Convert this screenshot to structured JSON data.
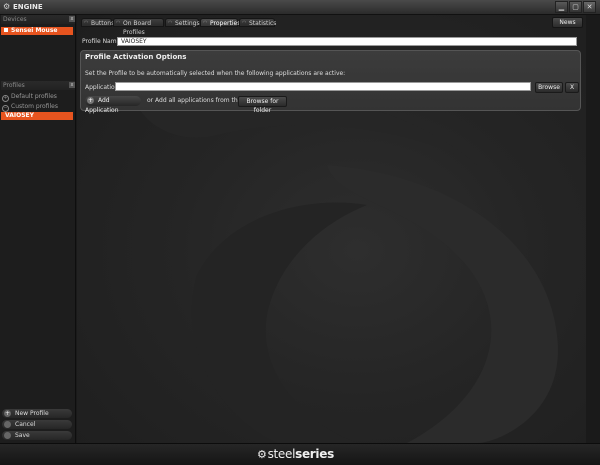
{
  "window": {
    "title": "ENGINE",
    "app_icon": "gear-icon",
    "minimize": "▁",
    "maximize": "▢",
    "close": "✕"
  },
  "sidebar": {
    "devices_header": "Devices",
    "devices": [
      {
        "label": "Sensei Mouse",
        "selected": true
      }
    ],
    "profiles_header": "Profiles",
    "groups": [
      {
        "label": "Default profiles",
        "icon": "plus-circle-icon",
        "glyph": "+"
      },
      {
        "label": "Custom profiles",
        "icon": "minus-circle-icon",
        "glyph": "−"
      }
    ],
    "profiles": [
      {
        "label": "VAIOSEY",
        "selected": true
      }
    ],
    "panel_close": "x",
    "buttons": {
      "new_profile": "New Profile",
      "cancel": "Cancel",
      "save": "Save"
    }
  },
  "tabs": [
    {
      "label": "Buttons"
    },
    {
      "label": "On Board Profiles"
    },
    {
      "label": "Settings"
    },
    {
      "label": "Properties",
      "active": true
    },
    {
      "label": "Statistics"
    }
  ],
  "news_label": "News",
  "profile": {
    "name_label": "Profile Name:",
    "name_value": "VAIOSEY"
  },
  "activation": {
    "title": "Profile Activation Options",
    "description": "Set the Profile to be automatically selected when the following applications are active:",
    "application_label": "Application:",
    "application_value": "",
    "browse_label": "Browse",
    "remove_label": "X",
    "add_application_label": "Add Application",
    "or_text": "or Add all applications from the folder:",
    "browse_folder_label": "Browse for folder"
  },
  "footer": {
    "brand_light": "steel",
    "brand_bold": "series"
  },
  "colors": {
    "accent": "#e7541f",
    "background": "#1a1a1a"
  }
}
